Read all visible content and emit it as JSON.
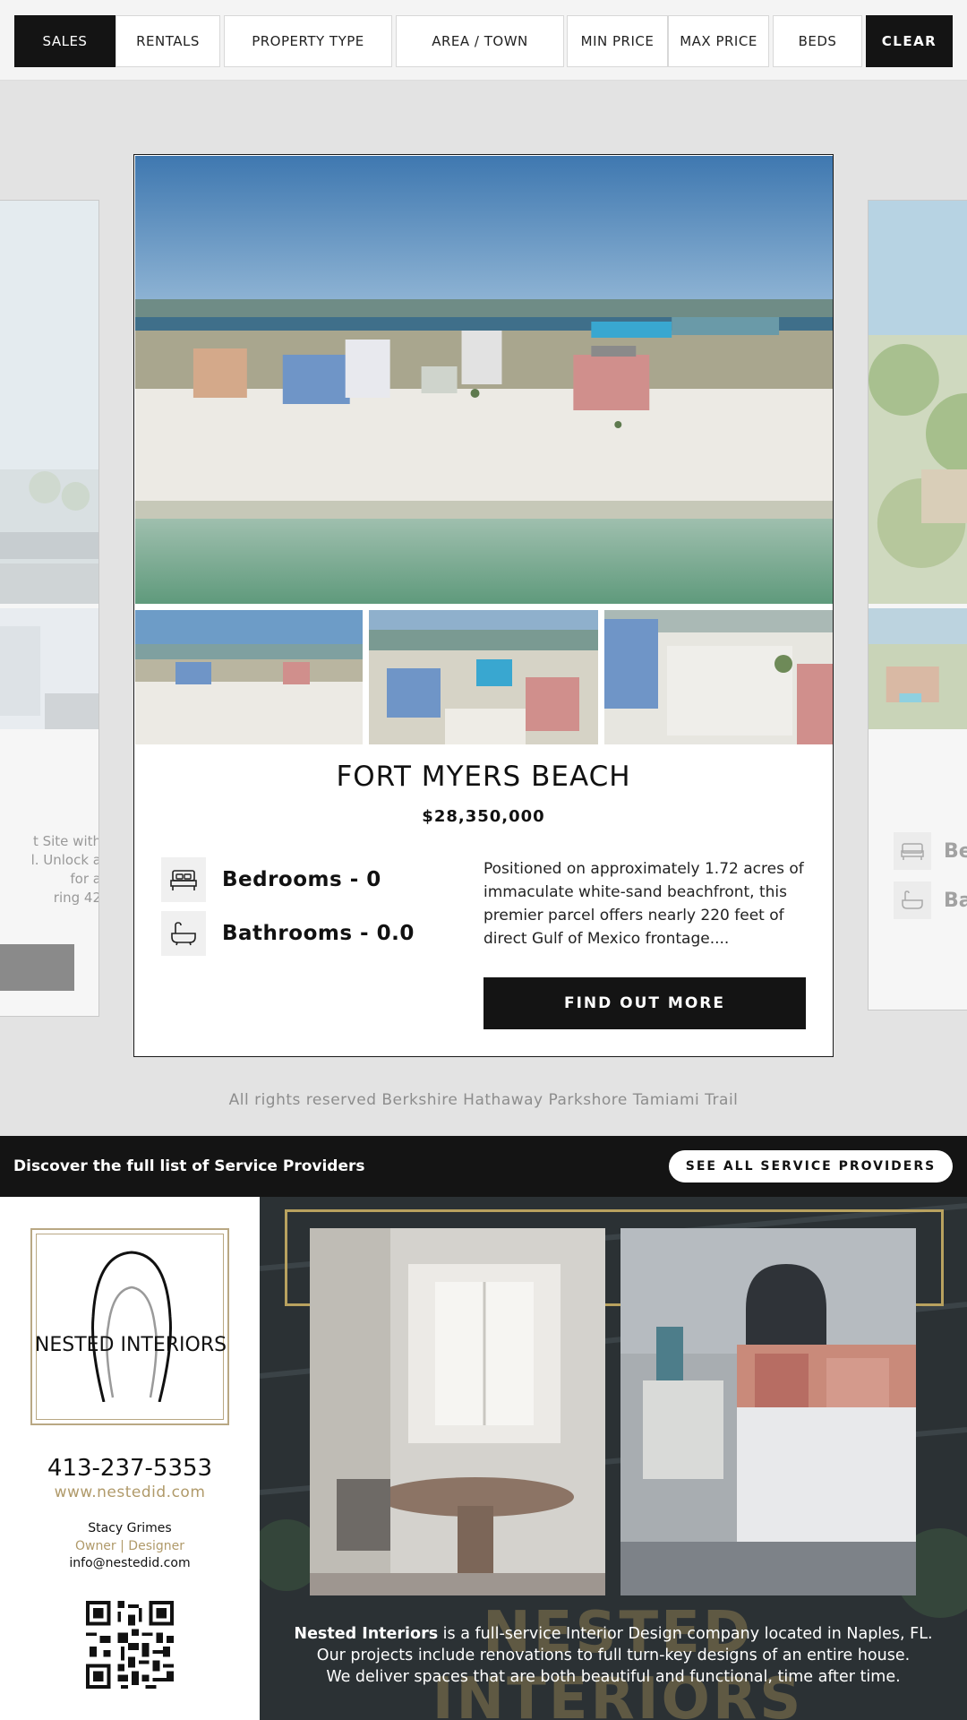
{
  "filters": {
    "sales": "SALES",
    "rentals": "RENTALS",
    "property_type": "PROPERTY TYPE",
    "area_town": "AREA / TOWN",
    "min_price": "MIN PRICE",
    "max_price": "MAX PRICE",
    "beds": "BEDS",
    "clear": "CLEAR"
  },
  "left_card": {
    "text_lines": [
      "t Site with",
      "l. Unlock a",
      "for a",
      "ring 42"
    ]
  },
  "right_card": {
    "bed_label": "Be",
    "bath_label": "Ba"
  },
  "listing": {
    "title": "FORT MYERS BEACH",
    "price": "$28,350,000",
    "bedrooms": "Bedrooms - 0",
    "bathrooms": "Bathrooms - 0.0",
    "description": "Positioned on approximately 1.72 acres of immaculate white-sand beachfront, this premier parcel offers nearly 220 feet of direct Gulf of Mexico frontage....",
    "cta": "FIND OUT MORE"
  },
  "footer_rights": "All rights reserved Berkshire Hathaway Parkshore Tamiami Trail",
  "service_bar": {
    "text": "Discover the full list of Service Providers",
    "button": "SEE ALL SERVICE PROVIDERS"
  },
  "ad": {
    "logo_text": "NESTED INTERIORS",
    "phone": "413-237-5353",
    "website": "www.nestedid.com",
    "person": "Stacy Grimes",
    "role": "Owner | Designer",
    "email": "info@nestedid.com",
    "watermark": "NESTED INTERIORS",
    "copy_brand": "Nested Interiors",
    "copy_line1": " is a full-service Interior Design company located in Naples, FL.",
    "copy_line2": "Our projects include renovations to full turn-key designs of an entire house.",
    "copy_line3": "We deliver spaces that are both beautiful and functional, time after time."
  },
  "colors": {
    "dark": "#141414",
    "gold": "#b09a6a",
    "background": "#e3e3e3"
  }
}
